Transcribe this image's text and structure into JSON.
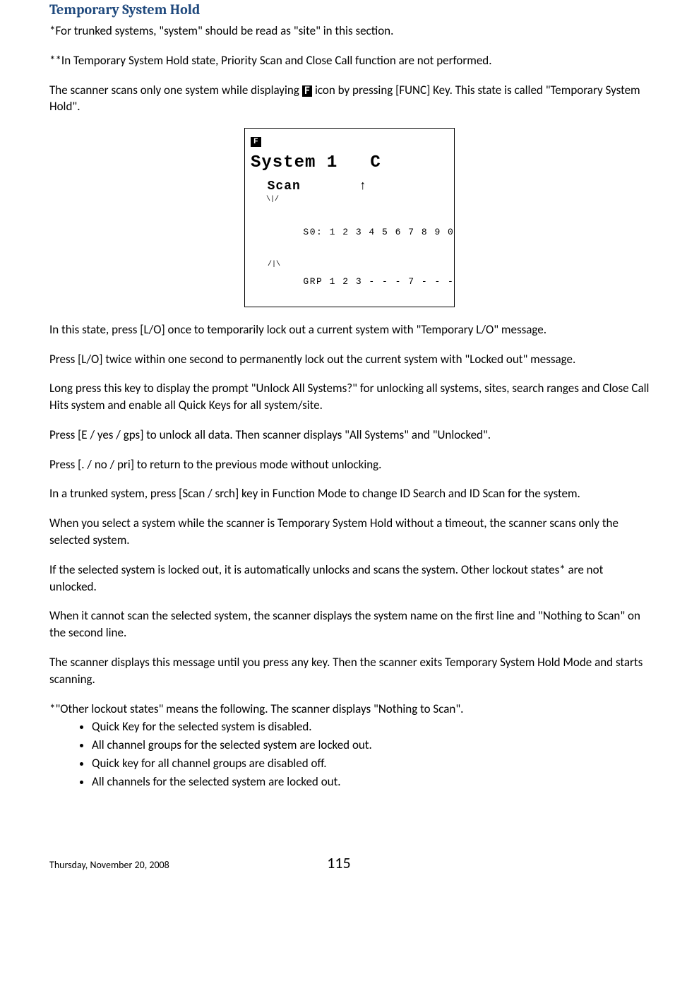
{
  "heading": "Temporary System Hold",
  "p1": "*For trunked systems, \"system\" should be read as \"site\" in this section.",
  "p2": "**In Temporary System Hold state, Priority Scan and Close Call function are not performed.",
  "p3a": "The scanner scans only one system while displaying ",
  "p3_icon": "F",
  "p3b": " icon by pressing [FUNC] Key. This state is called \"Temporary System Hold\".",
  "lcd": {
    "f": "F",
    "line1": "System 1   C",
    "line2": "  Scan       ↑",
    "s0": "S0: 1 2 3 4 5 6 7 8 9 0",
    "grp": "GRP 1 2 3 - - - 7 - - -",
    "sig_top": "\\|/",
    "sig_bot": "/|\\"
  },
  "p4": "In this state, press [L/O] once to temporarily lock out a current system with \"Temporary L/O\" message.",
  "p5": "Press [L/O] twice within one second to permanently lock out the current system with \"Locked out\" message.",
  "p6": "Long press this key to display the prompt \"Unlock All Systems?\" for unlocking all systems, sites, search ranges and Close Call Hits system and enable all Quick Keys for all system/site.",
  "p7": "Press [E / yes / gps] to unlock all data. Then scanner displays \"All Systems\" and \"Unlocked\".",
  "p8": "Press [. / no / pri] to return to the previous mode without unlocking.",
  "p9": "In a trunked system, press [Scan / srch] key in Function Mode to change ID Search and ID Scan for the system.",
  "p10": "When you select a system while the scanner is Temporary System Hold without a timeout, the scanner scans only the selected system.",
  "p11": "If the selected system is locked out, it is automatically unlocks and scans the system. Other lockout states* are not unlocked.",
  "p12": "When it cannot scan the selected system, the scanner displays the system name on the first line and \"Nothing to Scan\" on the second line.",
  "p13": "The scanner displays this message until you press any key. Then the scanner exits Temporary System Hold Mode and starts scanning.",
  "p14": "*\"Other lockout states\" means the following. The scanner displays \"Nothing to Scan\".",
  "bullets": [
    "Quick Key for the selected system is disabled.",
    "All channel groups for the selected system are locked out.",
    "Quick key for all channel groups are disabled off.",
    "All channels for the selected system are locked out."
  ],
  "footer_date": "Thursday, November 20, 2008",
  "footer_page": "115"
}
